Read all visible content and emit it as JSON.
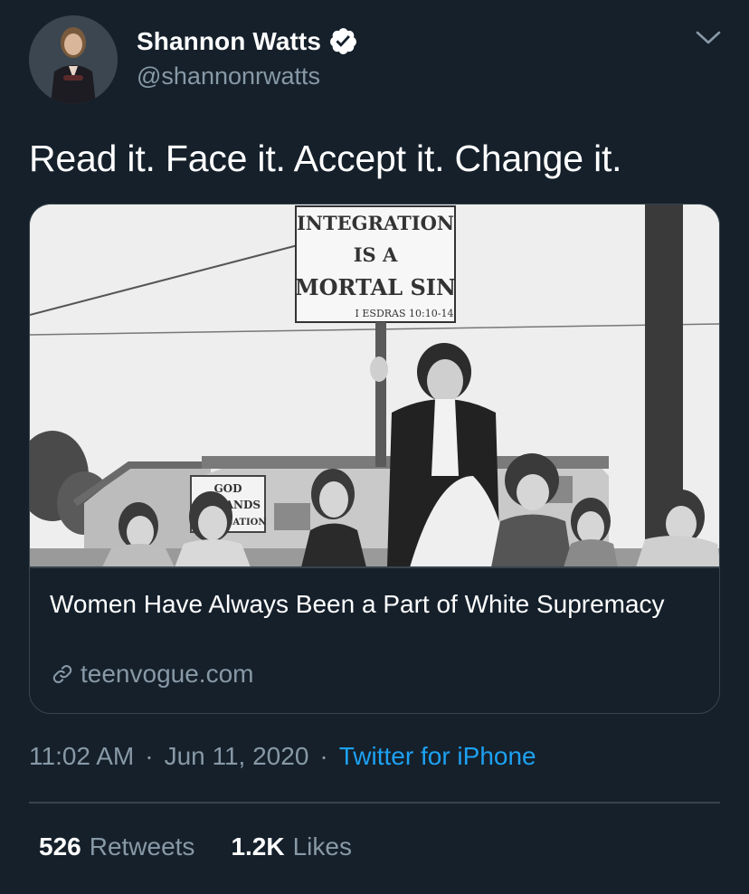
{
  "author": {
    "display_name": "Shannon Watts",
    "handle": "@shannonrwatts",
    "verified": true,
    "avatar_icon": "profile-photo"
  },
  "tweet": {
    "text": "Read it. Face it. Accept it. Change it."
  },
  "card": {
    "title": "Women Have Always Been a Part of White Supremacy",
    "domain": "teenvogue.com",
    "image_sign": {
      "line1": "INTEGRATION",
      "line2": "IS A",
      "line3": "MORTAL SIN",
      "line4": "I ESDRAS 10:10-14"
    },
    "image_sign_small": {
      "line1": "GOD",
      "line2": "DEMANDS",
      "line3": "SEGREGATION"
    }
  },
  "meta": {
    "time": "11:02 AM",
    "separator": "·",
    "date": "Jun 11, 2020",
    "source": "Twitter for iPhone"
  },
  "stats": {
    "retweets_count": "526",
    "retweets_label": "Retweets",
    "likes_count": "1.2K",
    "likes_label": "Likes"
  },
  "colors": {
    "background": "#15202b",
    "border": "#38444d",
    "secondary_text": "#8899a6",
    "accent": "#1da1f2"
  }
}
